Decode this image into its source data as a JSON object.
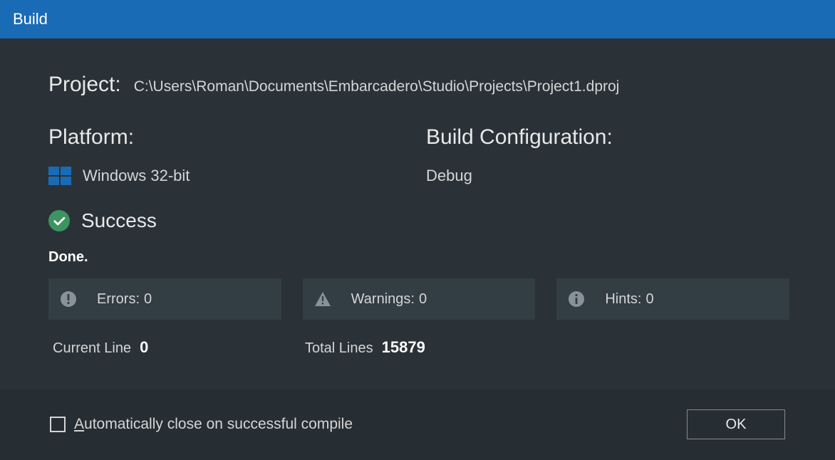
{
  "title": "Build",
  "project": {
    "label": "Project:",
    "path": "C:\\Users\\Roman\\Documents\\Embarcadero\\Studio\\Projects\\Project1.dproj"
  },
  "platform": {
    "label": "Platform:",
    "value": "Windows 32-bit"
  },
  "buildConfig": {
    "label": "Build Configuration:",
    "value": "Debug"
  },
  "status": {
    "text": "Success",
    "done": "Done."
  },
  "stats": {
    "errors": {
      "label": "Errors:",
      "value": "0"
    },
    "warnings": {
      "label": "Warnings:",
      "value": "0"
    },
    "hints": {
      "label": "Hints:",
      "value": "0"
    }
  },
  "lines": {
    "currentLabel": "Current Line",
    "currentValue": "0",
    "totalLabel": "Total Lines",
    "totalValue": "15879"
  },
  "footer": {
    "autoCloseLabel": "utomatically close on successful compile",
    "autoClosePrefix": "A",
    "okLabel": "OK"
  }
}
